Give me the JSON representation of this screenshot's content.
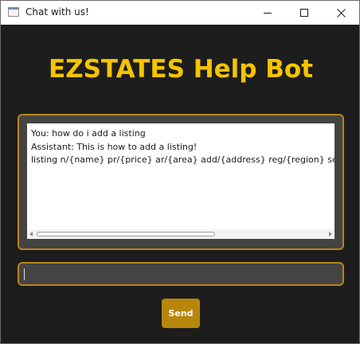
{
  "window": {
    "title": "Chat with us!",
    "icon": "app-window-icon"
  },
  "titlebar_controls": {
    "minimize_icon": "minimize-icon",
    "maximize_icon": "maximize-icon",
    "close_icon": "close-icon"
  },
  "header": {
    "title": "EZSTATES Help Bot"
  },
  "chat": {
    "lines": [
      "You: how do i add a listing",
      "Assistant: This is how to add a listing!",
      "listing n/{name} pr/{price} ar/{area} add/{address} reg/{region} sel/{seller}"
    ]
  },
  "input": {
    "value": "",
    "placeholder": ""
  },
  "actions": {
    "send_label": "Send"
  },
  "colors": {
    "background": "#1d1d1d",
    "accent": "#f5c400",
    "border": "#b58618",
    "button": "#b8860b"
  }
}
